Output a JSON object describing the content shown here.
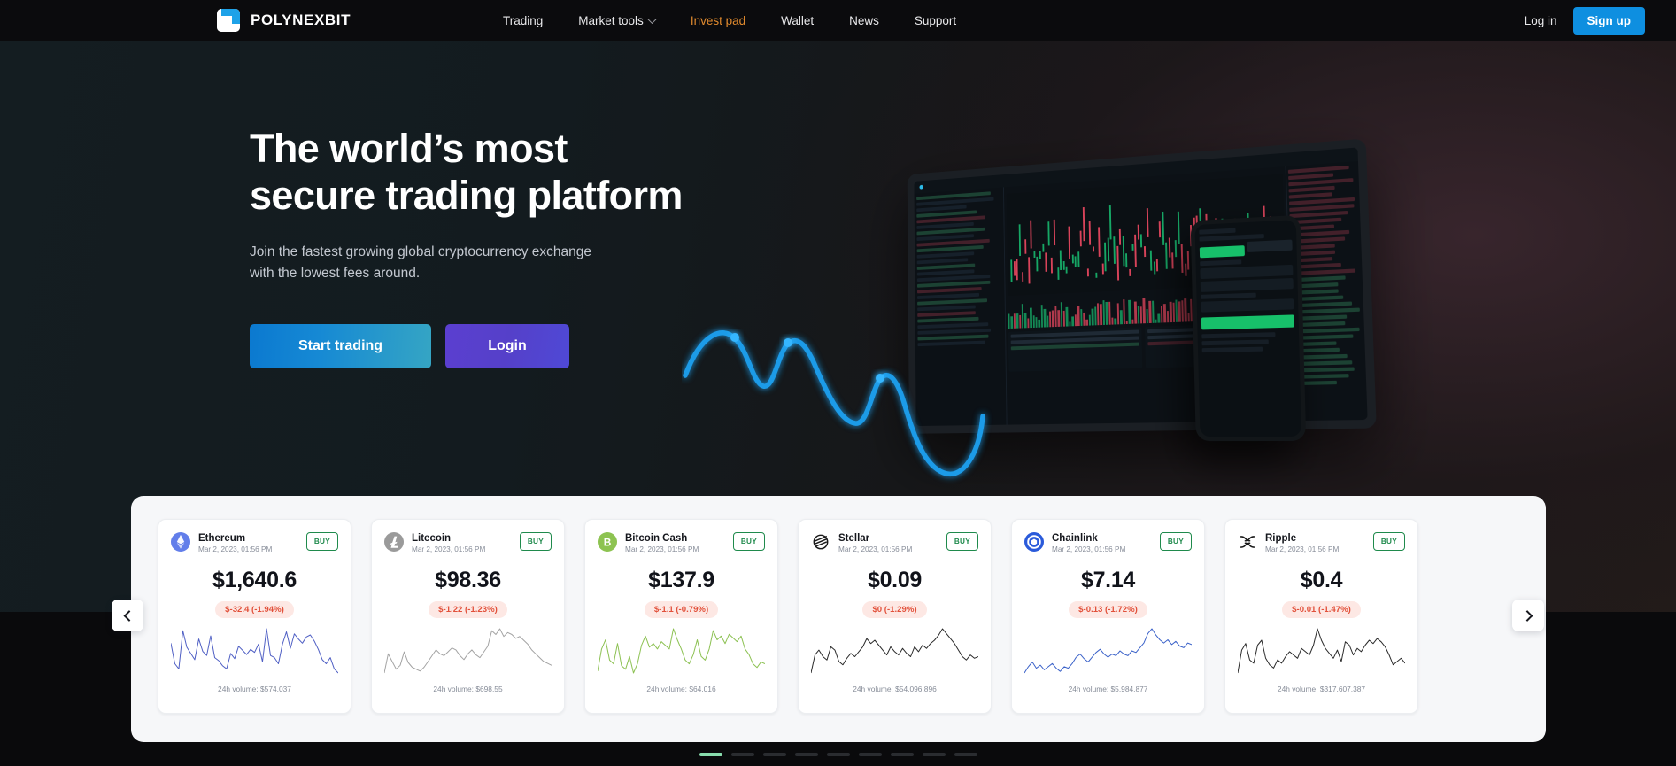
{
  "brand": {
    "name": "POLYNEXBIT",
    "logo_icon": "polynexbit-logo-icon",
    "accent": "#1ea2e8"
  },
  "nav": {
    "items": [
      {
        "label": "Trading",
        "active": false,
        "has_caret": false
      },
      {
        "label": "Market tools",
        "active": false,
        "has_caret": true
      },
      {
        "label": "Invest pad",
        "active": true,
        "has_caret": false
      },
      {
        "label": "Wallet",
        "active": false,
        "has_caret": false
      },
      {
        "label": "News",
        "active": false,
        "has_caret": false
      },
      {
        "label": "Support",
        "active": false,
        "has_caret": false
      }
    ],
    "login_label": "Log in",
    "signup_label": "Sign up",
    "active_color": "#e08a2e",
    "signup_color": "#0e8fe0"
  },
  "hero": {
    "title": "The world’s most\nsecure trading platform",
    "subtitle": "Join the fastest growing global cryptocurrency exchange\nwith the lowest fees around.",
    "primary_button": "Start trading",
    "secondary_button": "Login",
    "primary_gradient": "#0b79d0",
    "secondary_gradient": "#5b3fd0",
    "mockup_alt": "trading-platform-laptop-and-phone-mockup",
    "wave_color": "#1c9be8"
  },
  "carousel": {
    "prev_label": "chevron-left-icon",
    "next_label": "chevron-right-icon",
    "buy_label": "BUY",
    "volume_prefix": "24h volume: ",
    "active_dot_color": "#88dcad",
    "dots_total": 9,
    "dots_active_index": 0,
    "cards": [
      {
        "name": "Ethereum",
        "timestamp": "Mar 2, 2023, 01:56 PM",
        "price": "$1,640.6",
        "change": "$-32.4 (-1.94%)",
        "volume": "24h volume: $574,037",
        "icon": "ethereum-icon",
        "icon_color": "#627eea",
        "spark_color": "#4f5fc4",
        "spark": [
          34,
          14,
          9,
          46,
          30,
          24,
          18,
          38,
          26,
          22,
          41,
          20,
          17,
          12,
          9,
          24,
          19,
          31,
          27,
          23,
          28,
          25,
          33,
          16,
          48,
          22,
          20,
          14,
          33,
          45,
          29,
          43,
          38,
          34,
          40,
          42,
          36,
          28,
          18,
          14,
          20,
          9,
          5
        ]
      },
      {
        "name": "Litecoin",
        "timestamp": "Mar 2, 2023, 01:56 PM",
        "price": "$98.36",
        "change": "$-1.22 (-1.23%)",
        "volume": "24h volume: $698,55",
        "icon": "litecoin-icon",
        "icon_color": "#9a9a9a",
        "spark_color": "#a3a3a3",
        "spark": [
          6,
          26,
          18,
          10,
          14,
          28,
          17,
          12,
          10,
          8,
          12,
          18,
          24,
          30,
          26,
          24,
          28,
          32,
          30,
          24,
          20,
          26,
          30,
          25,
          22,
          28,
          34,
          50,
          46,
          52,
          44,
          48,
          46,
          42,
          44,
          40,
          36,
          30,
          26,
          22,
          18,
          16,
          14
        ]
      },
      {
        "name": "Bitcoin Cash",
        "timestamp": "Mar 2, 2023, 01:56 PM",
        "price": "$137.9",
        "change": "$-1.1 (-0.79%)",
        "volume": "24h volume: $64,016",
        "icon": "bitcoin-cash-icon",
        "icon_color": "#8dc351",
        "spark_color": "#8cc152",
        "spark": [
          6,
          30,
          40,
          18,
          14,
          36,
          12,
          8,
          22,
          4,
          14,
          34,
          44,
          32,
          36,
          30,
          38,
          34,
          30,
          52,
          40,
          30,
          18,
          14,
          24,
          40,
          22,
          18,
          30,
          50,
          40,
          44,
          36,
          46,
          42,
          38,
          44,
          30,
          24,
          14,
          10,
          16,
          14
        ]
      },
      {
        "name": "Stellar",
        "timestamp": "Mar 2, 2023, 01:56 PM",
        "price": "$0.09",
        "change": "$0 (-1.29%)",
        "volume": "24h volume: $54,096,896",
        "icon": "stellar-icon",
        "icon_color": "#1a1a1a",
        "spark_color": "#2a2a2a",
        "spark": [
          2,
          24,
          30,
          22,
          18,
          34,
          30,
          16,
          12,
          20,
          26,
          22,
          28,
          34,
          44,
          38,
          42,
          36,
          30,
          24,
          34,
          28,
          24,
          32,
          26,
          22,
          34,
          28,
          36,
          32,
          38,
          42,
          48,
          56,
          50,
          44,
          38,
          30,
          22,
          18,
          24,
          20,
          22
        ]
      },
      {
        "name": "Chainlink",
        "timestamp": "Mar 2, 2023, 01:56 PM",
        "price": "$7.14",
        "change": "$-0.13 (-1.72%)",
        "volume": "24h volume: $5,984,877",
        "icon": "chainlink-icon",
        "icon_color": "#2a5ada",
        "spark_color": "#3b62c9",
        "spark": [
          6,
          14,
          20,
          12,
          16,
          10,
          14,
          18,
          12,
          8,
          14,
          12,
          18,
          26,
          30,
          24,
          20,
          26,
          32,
          36,
          30,
          26,
          30,
          28,
          34,
          30,
          28,
          34,
          32,
          38,
          44,
          56,
          62,
          54,
          48,
          44,
          48,
          42,
          46,
          40,
          38,
          44,
          42
        ]
      },
      {
        "name": "Ripple",
        "timestamp": "Mar 2, 2023, 01:56 PM",
        "price": "$0.4",
        "change": "$-0.01 (-1.47%)",
        "volume": "24h volume: $317,607,387",
        "icon": "ripple-icon",
        "icon_color": "#1a1a1a",
        "spark_color": "#2a2a2a",
        "spark": [
          4,
          32,
          40,
          20,
          16,
          38,
          44,
          22,
          14,
          10,
          20,
          16,
          24,
          30,
          26,
          22,
          34,
          30,
          26,
          38,
          58,
          44,
          34,
          28,
          22,
          32,
          18,
          42,
          38,
          26,
          34,
          30,
          38,
          44,
          40,
          46,
          42,
          36,
          26,
          14,
          18,
          22,
          16
        ]
      }
    ]
  }
}
